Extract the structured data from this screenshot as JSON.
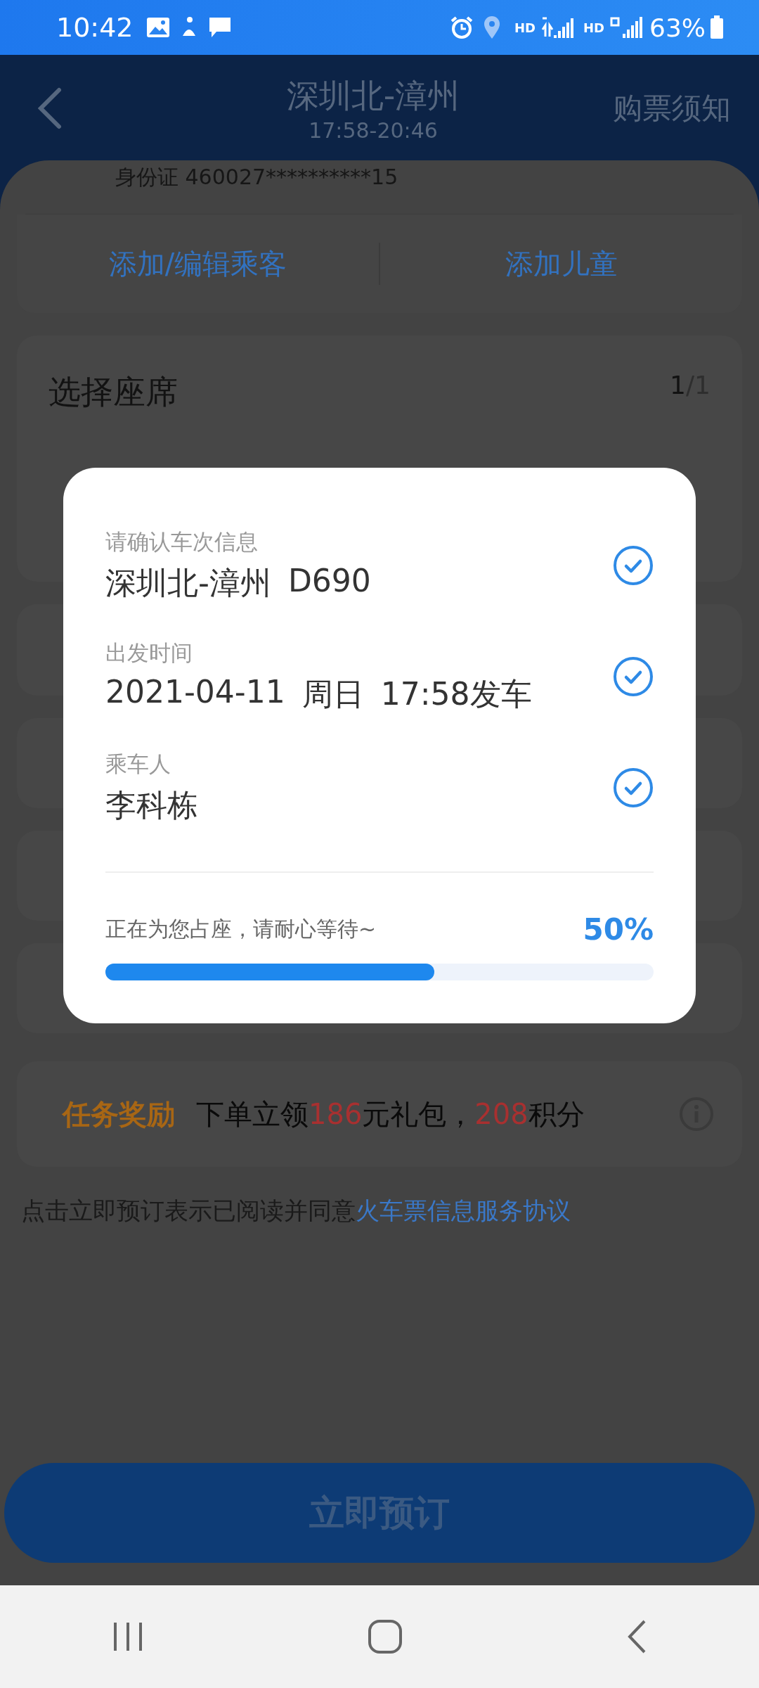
{
  "status_bar": {
    "time": "10:42",
    "network_labels": [
      "HD",
      "HD"
    ],
    "battery": "63%"
  },
  "header": {
    "title": "深圳北-漳州",
    "subtitle": "17:58-20:46",
    "action": "购票须知"
  },
  "passenger": {
    "id_line": "身份证 460027**********15"
  },
  "passenger_actions": [
    "添加/编辑乘客",
    "添加儿童"
  ],
  "seat_section": {
    "title": "选择座席",
    "count_current": "1",
    "count_sep": "/",
    "count_total": "1"
  },
  "dialog": {
    "items": [
      {
        "label": "请确认车次信息",
        "value": [
          "深圳北-漳州",
          "D690"
        ],
        "checked": true
      },
      {
        "label": "出发时间",
        "value": [
          "2021-04-11",
          "周日",
          "17:58发车"
        ],
        "checked": true
      },
      {
        "label": "乘车人",
        "value": [
          "李科栋"
        ],
        "checked": true
      }
    ],
    "progress_text": "正在为您占座，请耐心等待~",
    "progress_reading": "50%",
    "level": 0.6
  },
  "reward": {
    "title": "任务奖励",
    "segments": [
      {
        "text": "下单立领",
        "highlight": false
      },
      {
        "text": "186",
        "highlight": true
      },
      {
        "text": "元礼包，",
        "highlight": false
      },
      {
        "text": "208",
        "highlight": true
      },
      {
        "text": "积分",
        "highlight": false
      }
    ]
  },
  "agreement": {
    "text": "点击立即预订表示已阅读并同意",
    "link": "火车票信息服务协议"
  },
  "book_button": "立即预订"
}
